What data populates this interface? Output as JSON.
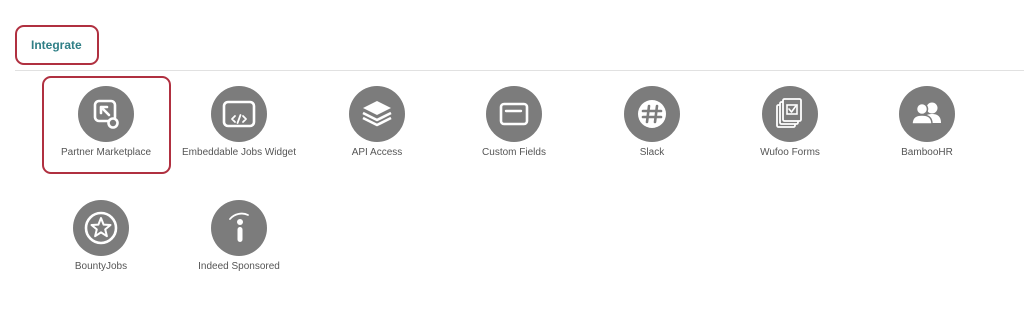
{
  "tabs": {
    "integrate": "Integrate"
  },
  "integrations": [
    {
      "label": "Partner Marketplace",
      "icon": "cursor-click-icon"
    },
    {
      "label": "Embeddable Jobs Widget",
      "icon": "code-window-icon"
    },
    {
      "label": "API Access",
      "icon": "layers-icon"
    },
    {
      "label": "Custom Fields",
      "icon": "text-field-icon"
    },
    {
      "label": "Slack",
      "icon": "slack-hash-icon"
    },
    {
      "label": "Wufoo Forms",
      "icon": "form-documents-icon"
    },
    {
      "label": "BambooHR",
      "icon": "users-icon"
    },
    {
      "label": "BountyJobs",
      "icon": "star-badge-icon"
    },
    {
      "label": "Indeed Sponsored",
      "icon": "info-i-icon"
    }
  ],
  "colors": {
    "icon_circle": "#7c7c7c",
    "highlight_border": "#b03040",
    "tab_text": "#2f7f86",
    "label_text": "#555555"
  }
}
